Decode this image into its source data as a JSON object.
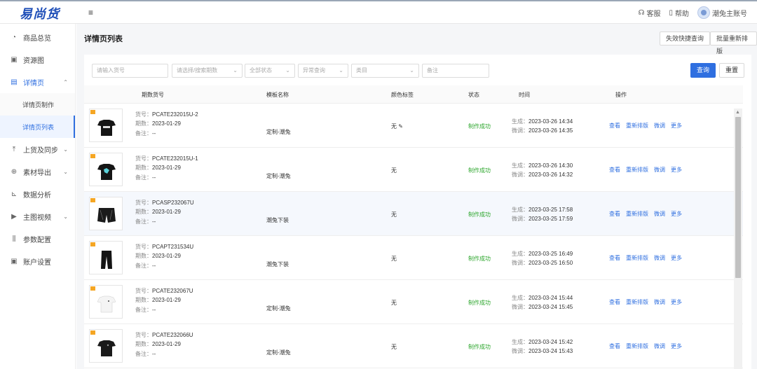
{
  "app": {
    "logo": "易尚货",
    "menu_icon": "≡"
  },
  "topbar": {
    "items": [
      {
        "icon": "headset-icon",
        "label": "客服"
      },
      {
        "icon": "book-icon",
        "label": "帮助"
      }
    ],
    "account": "潮兔主账号"
  },
  "sidebar": {
    "items": [
      {
        "name": "商品总览",
        "icon": "clock-icon",
        "glyph": "◔"
      },
      {
        "name": "资源图",
        "icon": "image-icon",
        "glyph": "▣"
      },
      {
        "name": "详情页",
        "icon": "page-icon",
        "glyph": "▤",
        "expanded": true,
        "children": [
          "详情页制作",
          "详情页列表"
        ]
      },
      {
        "name": "上货及同步",
        "icon": "upload-icon",
        "glyph": "⤒",
        "chevron": true
      },
      {
        "name": "素材导出",
        "icon": "export-icon",
        "glyph": "⊕",
        "chevron": true
      },
      {
        "name": "数据分析",
        "icon": "chart-icon",
        "glyph": "⊾"
      },
      {
        "name": "主图视频",
        "icon": "video-icon",
        "glyph": "▶",
        "chevron": true
      },
      {
        "name": "参数配置",
        "icon": "settings-icon",
        "glyph": "⫼"
      },
      {
        "name": "账户设置",
        "icon": "account-icon",
        "glyph": "▣"
      }
    ],
    "current_sub": "详情页列表"
  },
  "main": {
    "title": "详情页列表",
    "buttons": {
      "quick_query": "失效快捷查询",
      "batch_rebuild": "批量重新排版"
    }
  },
  "filters": {
    "sku_placeholder": "请输入货号",
    "period_placeholder": "请选择/搜索期数",
    "state_placeholder": "全部状态",
    "exception_placeholder": "异常查询",
    "category_placeholder": "类目",
    "note_placeholder": "备注",
    "search_label": "查询",
    "reset_label": "重置"
  },
  "table": {
    "headers": [
      "期数货号",
      "模板名称",
      "颜色标签",
      "状态",
      "时间",
      "操作"
    ],
    "labels": {
      "sku": "货号：",
      "period": "期数：",
      "note": "备注：",
      "created": "生成：",
      "tuned": "微调："
    },
    "ops": [
      "查看",
      "重新排版",
      "微调",
      "更多"
    ],
    "rows": [
      {
        "sku": "PCATE232015U-2",
        "period": "2023-01-29",
        "note": "--",
        "template": "定制-潮兔",
        "color": "无 ✎",
        "status": "制作成功",
        "created": "2023-03-26 14:34",
        "tuned": "2023-03-26 14:35",
        "product": "black-tee-print"
      },
      {
        "sku": "PCATE232015U-1",
        "period": "2023-01-29",
        "note": "--",
        "template": "定制-潮兔",
        "color": "无",
        "status": "制作成功",
        "created": "2023-03-26 14:30",
        "tuned": "2023-03-26 14:32",
        "product": "black-tee-cyan"
      },
      {
        "sku": "PCASP232067U",
        "period": "2023-01-29",
        "note": "--",
        "template": "潮兔下装",
        "color": "无",
        "status": "制作成功",
        "created": "2023-03-25 17:58",
        "tuned": "2023-03-25 17:59",
        "product": "black-shorts"
      },
      {
        "sku": "PCAPT231534U",
        "period": "2023-01-29",
        "note": "--",
        "template": "潮兔下装",
        "color": "无",
        "status": "制作成功",
        "created": "2023-03-25 16:49",
        "tuned": "2023-03-25 16:50",
        "product": "black-pants"
      },
      {
        "sku": "PCATE232067U",
        "period": "2023-01-29",
        "note": "--",
        "template": "定制-潮兔",
        "color": "无",
        "status": "制作成功",
        "created": "2023-03-24 15:44",
        "tuned": "2023-03-24 15:45",
        "product": "white-tee"
      },
      {
        "sku": "PCATE232066U",
        "period": "2023-01-29",
        "note": "--",
        "template": "定制-潮兔",
        "color": "无",
        "status": "制作成功",
        "created": "2023-03-24 15:42",
        "tuned": "2023-03-24 15:43",
        "product": "black-tee"
      }
    ]
  },
  "colors": {
    "accent": "#2f6fe0",
    "success": "#2aa52a",
    "logo": "#1f4fb8"
  }
}
